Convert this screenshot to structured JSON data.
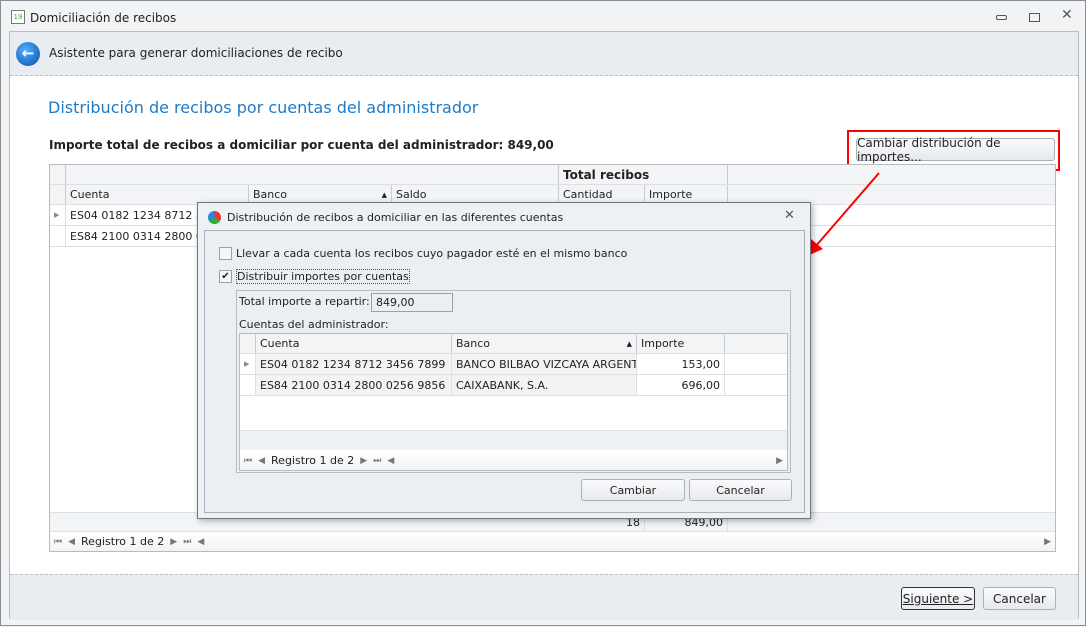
{
  "window": {
    "title": "Domiciliación de recibos",
    "icon": "calendar-download-icon",
    "controls": [
      "minimize-icon",
      "restore-icon",
      "close-icon"
    ]
  },
  "wizard": {
    "subtitle": "Asistente para generar domiciliaciones de recibo",
    "heading": "Distribución de recibos por cuentas del administrador",
    "total_label": "Importe total de recibos a domiciliar por cuenta del administrador: 849,00",
    "change_button": "Cambiar distribución de importes...",
    "next_button": "Siguiente >",
    "cancel_button": "Cancelar"
  },
  "main_grid": {
    "band": "Total recibos",
    "columns": [
      "Cuenta",
      "Banco",
      "Saldo",
      "Cantidad",
      "Importe"
    ],
    "rows": [
      {
        "cuenta": "ES04 0182 1234 8712 3456 7899"
      },
      {
        "cuenta": "ES84 2100 0314 2800 0256 9856"
      }
    ],
    "footer": {
      "cantidad": "18",
      "importe": "849,00"
    },
    "nav": "Registro 1 de 2"
  },
  "dialog": {
    "title": "Distribución de recibos a domiciliar en las diferentes cuentas",
    "check1": {
      "label": "Llevar a cada cuenta los recibos cuyo pagador esté en el mismo banco",
      "checked": false
    },
    "check2": {
      "label": "Distribuir importes por cuentas",
      "checked": true
    },
    "total_label": "Total importe a repartir:",
    "total_value": "849,00",
    "accounts_label": "Cuentas del administrador:",
    "columns": [
      "Cuenta",
      "Banco",
      "Importe"
    ],
    "rows": [
      {
        "cuenta": "ES04 0182 1234 8712 3456 7899",
        "banco": "BANCO BILBAO VIZCAYA ARGENT...",
        "importe": "153,00"
      },
      {
        "cuenta": "ES84 2100 0314 2800 0256 9856",
        "banco": "CAIXABANK, S.A.",
        "importe": "696,00"
      }
    ],
    "nav": "Registro 1 de 2",
    "ok_button": "Cambiar",
    "cancel_button": "Cancelar"
  },
  "colors": {
    "heading": "#1e7bc8",
    "highlight": "#ff0000"
  }
}
